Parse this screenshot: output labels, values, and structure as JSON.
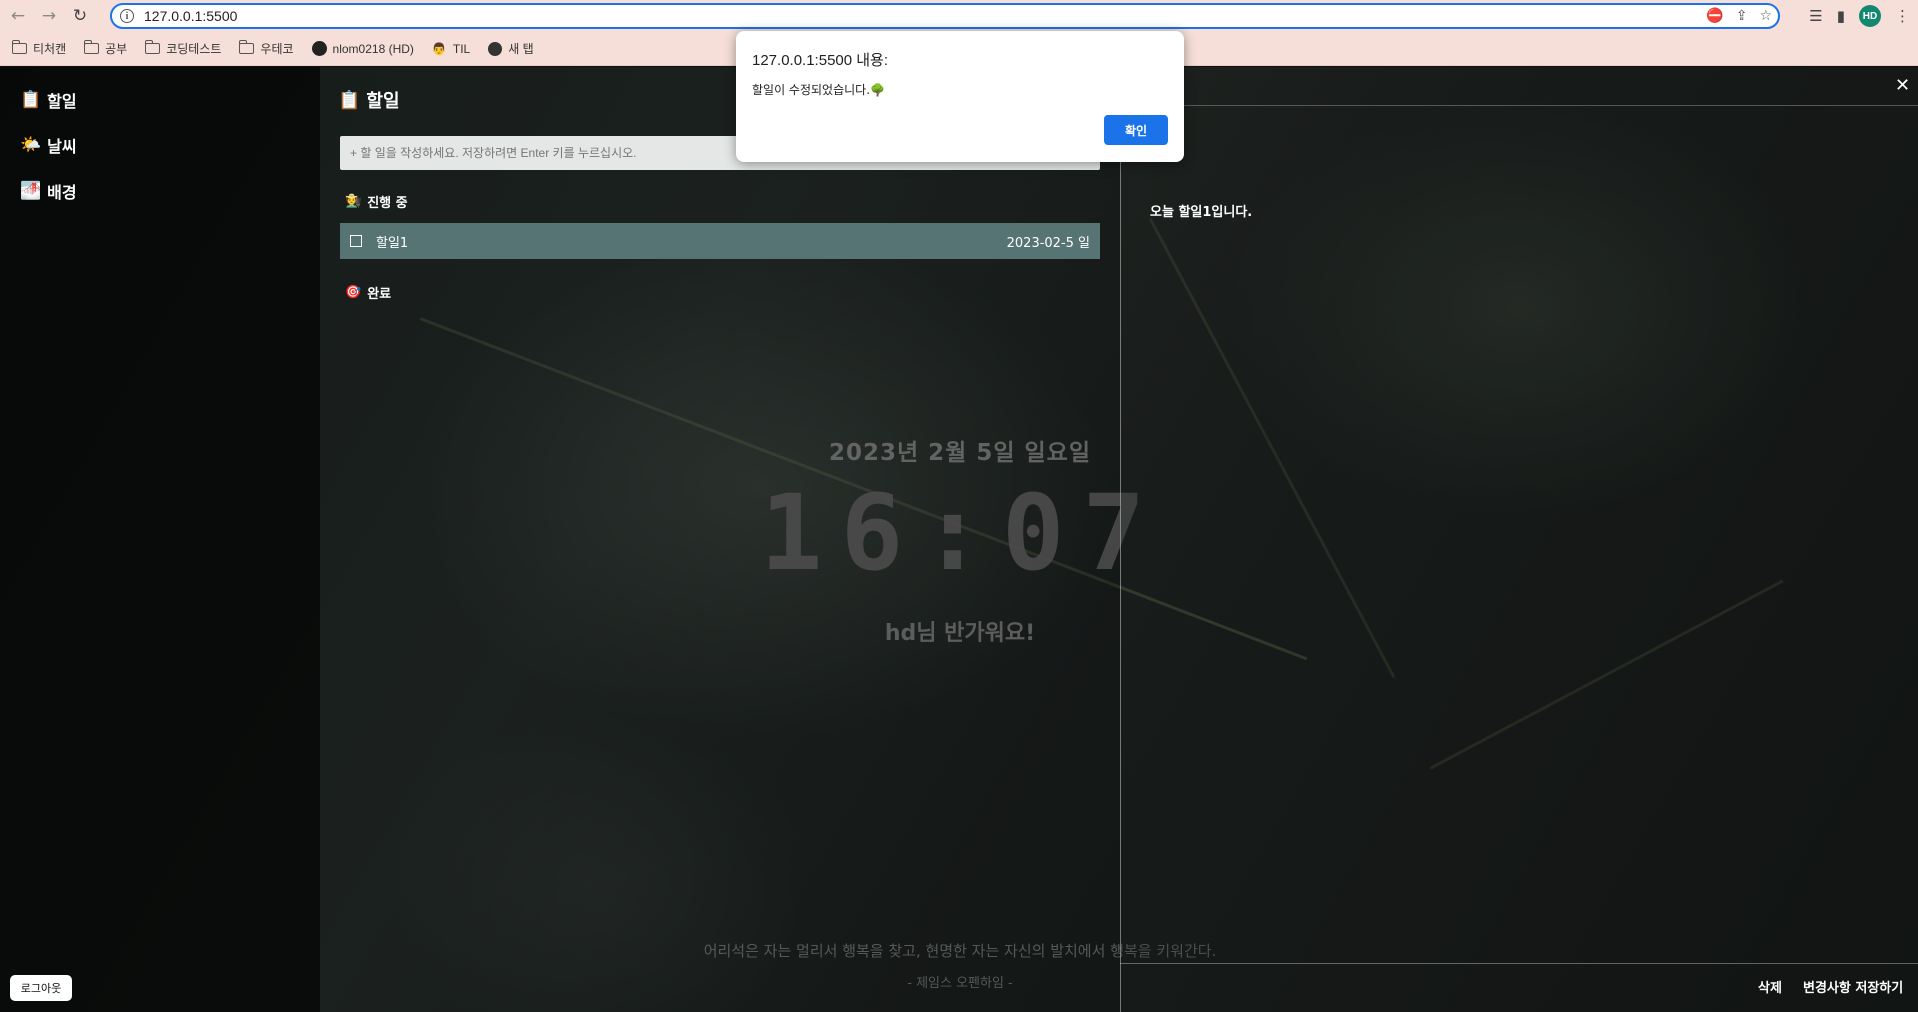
{
  "browser": {
    "url": "127.0.0.1:5500",
    "avatar_initials": "HD",
    "bookmarks": [
      {
        "label": "티처캔",
        "icon": "folder-icon"
      },
      {
        "label": "공부",
        "icon": "folder-icon"
      },
      {
        "label": "코딩테스트",
        "icon": "folder-icon"
      },
      {
        "label": "우테코",
        "icon": "folder-icon"
      },
      {
        "label": "nlom0218 (HD)",
        "icon": "github-icon"
      },
      {
        "label": "TIL",
        "icon": "person-emoji-icon"
      },
      {
        "label": "새 탭",
        "icon": "globe-icon"
      }
    ]
  },
  "sidebar": {
    "items": [
      {
        "icon": "📋",
        "label": "할일"
      },
      {
        "icon": "🌤️",
        "label": "날씨"
      },
      {
        "icon": "🌁",
        "label": "배경"
      }
    ],
    "logout_label": "로그아웃"
  },
  "todo": {
    "title_icon": "📋",
    "title": "할일",
    "input_placeholder": "+ 할 일을 작성하세요. 저장하려면 Enter 키를 누르십시오.",
    "in_progress_icon": "🧑‍🌾",
    "in_progress_label": "진행 중",
    "items": [
      {
        "label": "할일1",
        "date": "2023-02-5 일"
      }
    ],
    "done_icon": "🎯",
    "done_label": "완료"
  },
  "home": {
    "date": "2023년 2월 5일 일요일",
    "time": "16:07",
    "greeting": "hd님 반가워요!",
    "quote": "어리석은 자는 멀리서 행복을 찾고, 현명한 자는 자신의 발치에서 행복을 키워간다.",
    "author": "- 제임스 오펜하임 -"
  },
  "detail": {
    "close_glyph": "✕",
    "text": "오늘 할일1입니다.",
    "delete_label": "삭제",
    "save_label": "변경사항 저장하기"
  },
  "alert": {
    "title": "127.0.0.1:5500 내용:",
    "message": "할일이 수정되었습니다.🌳",
    "ok_label": "확인"
  },
  "colors": {
    "accent": "#1a73e8",
    "todo_row": "#567474",
    "chrome_bg": "#f6dfd8"
  }
}
